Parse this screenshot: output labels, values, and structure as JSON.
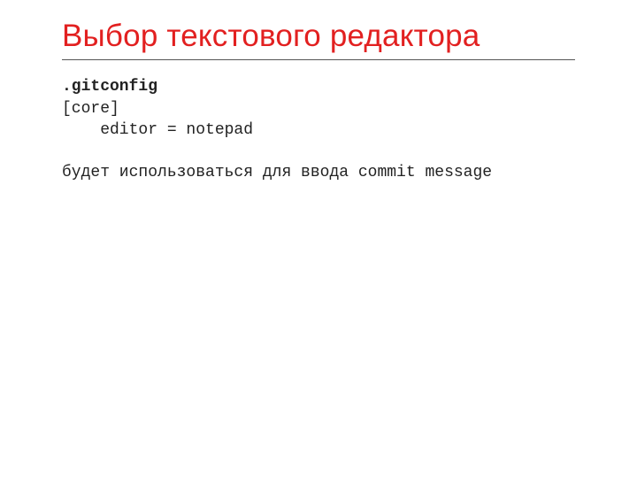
{
  "title": "Выбор текстового редактора",
  "code": {
    "label": ".gitconfig",
    "line1": "[core]",
    "line2": "    editor = notepad"
  },
  "note": "будет использоваться для ввода commit message"
}
